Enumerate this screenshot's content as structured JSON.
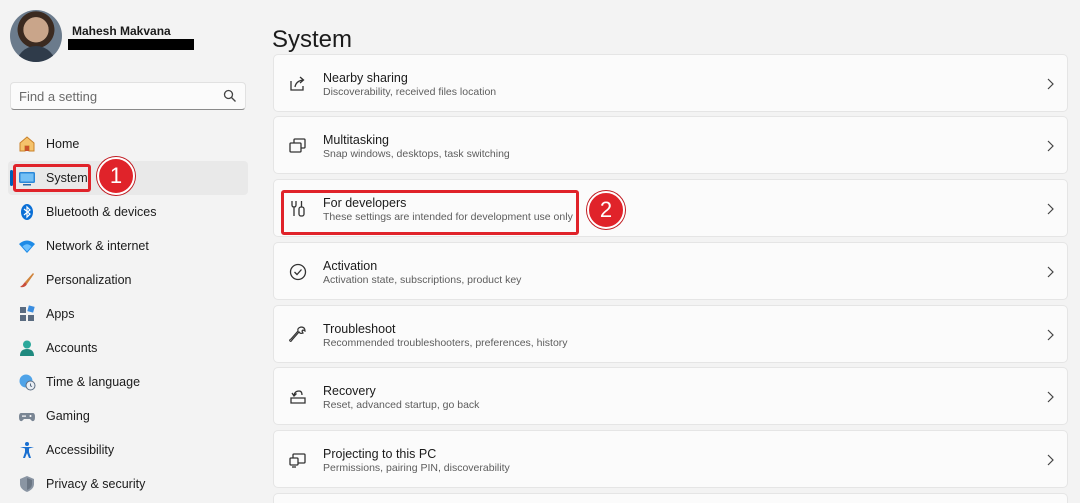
{
  "profile": {
    "name": "Mahesh Makvana"
  },
  "search": {
    "placeholder": "Find a setting"
  },
  "sidebar": {
    "items": [
      {
        "label": "Home",
        "icon": "home-icon"
      },
      {
        "label": "System",
        "icon": "system-icon",
        "active": true
      },
      {
        "label": "Bluetooth & devices",
        "icon": "bluetooth-icon"
      },
      {
        "label": "Network & internet",
        "icon": "wifi-icon"
      },
      {
        "label": "Personalization",
        "icon": "brush-icon"
      },
      {
        "label": "Apps",
        "icon": "apps-icon"
      },
      {
        "label": "Accounts",
        "icon": "person-icon"
      },
      {
        "label": "Time & language",
        "icon": "globe-clock-icon"
      },
      {
        "label": "Gaming",
        "icon": "gamepad-icon"
      },
      {
        "label": "Accessibility",
        "icon": "accessibility-icon"
      },
      {
        "label": "Privacy & security",
        "icon": "shield-icon"
      }
    ]
  },
  "annotations": {
    "step1": "1",
    "step2": "2",
    "highlight_color": "#e0232a"
  },
  "main": {
    "title": "System",
    "cards": [
      {
        "title": "Nearby sharing",
        "description": "Discoverability, received files location",
        "icon": "share-icon"
      },
      {
        "title": "Multitasking",
        "description": "Snap windows, desktops, task switching",
        "icon": "multitasking-icon"
      },
      {
        "title": "For developers",
        "description": "These settings are intended for development use only",
        "icon": "developer-tools-icon"
      },
      {
        "title": "Activation",
        "description": "Activation state, subscriptions, product key",
        "icon": "check-circle-icon"
      },
      {
        "title": "Troubleshoot",
        "description": "Recommended troubleshooters, preferences, history",
        "icon": "wrench-icon"
      },
      {
        "title": "Recovery",
        "description": "Reset, advanced startup, go back",
        "icon": "recovery-icon"
      },
      {
        "title": "Projecting to this PC",
        "description": "Permissions, pairing PIN, discoverability",
        "icon": "projecting-icon"
      }
    ]
  },
  "colors": {
    "accent": "#005fb8",
    "background": "#f3f3f3",
    "card": "#fbfbfb"
  }
}
